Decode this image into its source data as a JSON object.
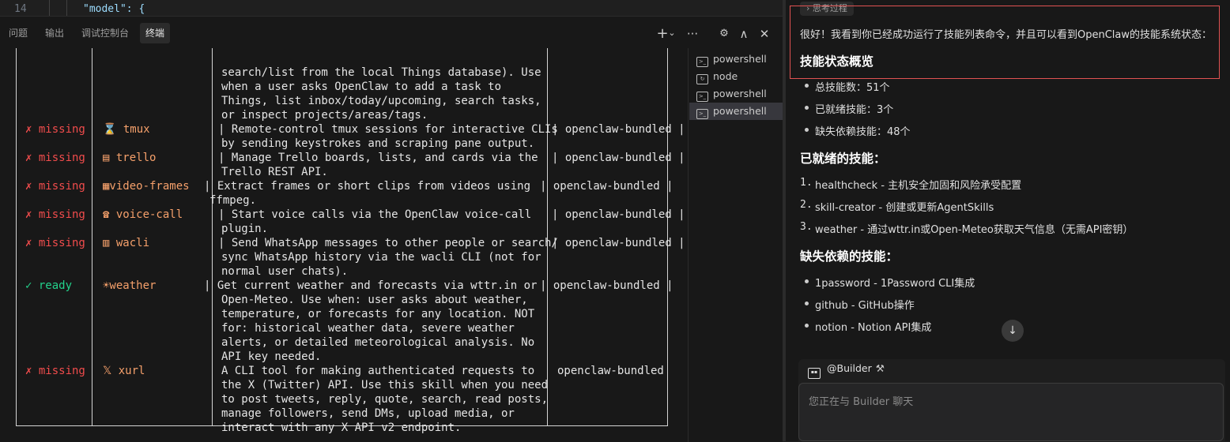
{
  "editor": {
    "line_number": "14",
    "code": "\"model\": {"
  },
  "panel": {
    "tabs": [
      "问题",
      "输出",
      "调试控制台",
      "终端"
    ],
    "active_tab": "终端",
    "actions": {
      "add": "+",
      "add_dropdown": "⌄",
      "more": "···",
      "layout": "⚙",
      "maximize": "∧",
      "close": "✕"
    }
  },
  "terminal": {
    "lines": [
      {
        "row": 0,
        "col": 280,
        "text": "search/list from the local Things database). Use",
        "style": "white"
      },
      {
        "row": 1,
        "col": 280,
        "text": "when a user asks OpenClaw to add a task to",
        "style": "white"
      },
      {
        "row": 2,
        "col": 280,
        "text": "Things, list inbox/today/upcoming, search tasks,",
        "style": "white"
      },
      {
        "row": 3,
        "col": 280,
        "text": "or inspect projects/areas/tags.",
        "style": "white"
      },
      {
        "row": 4,
        "col": 32,
        "text": "✗ missing",
        "style": "red"
      },
      {
        "row": 4,
        "col": 130,
        "text": "⌛ tmux",
        "style": "orange"
      },
      {
        "row": 4,
        "col": 276,
        "text": "| Remote-control tmux sessions for interactive CLIs",
        "style": "white"
      },
      {
        "row": 4,
        "col": 698,
        "text": "| openclaw-bundled |",
        "style": "white"
      },
      {
        "row": 5,
        "col": 280,
        "text": "by sending keystrokes and scraping pane output.",
        "style": "white"
      },
      {
        "row": 6,
        "col": 32,
        "text": "✗ missing",
        "style": "red"
      },
      {
        "row": 6,
        "col": 130,
        "text": "▤ trello",
        "style": "orange"
      },
      {
        "row": 6,
        "col": 276,
        "text": "| Manage Trello boards, lists, and cards via the",
        "style": "white"
      },
      {
        "row": 6,
        "col": 698,
        "text": "| openclaw-bundled |",
        "style": "white"
      },
      {
        "row": 7,
        "col": 280,
        "text": "Trello REST API.",
        "style": "white"
      },
      {
        "row": 8,
        "col": 32,
        "text": "✗ missing",
        "style": "red"
      },
      {
        "row": 8,
        "col": 130,
        "text": "▦video-frames",
        "style": "orange"
      },
      {
        "row": 8,
        "col": 258,
        "text": "| Extract frames or short clips from videos using",
        "style": "white"
      },
      {
        "row": 8,
        "col": 683,
        "text": "| openclaw-bundled |",
        "style": "white"
      },
      {
        "row": 9,
        "col": 265,
        "text": "ffmpeg.",
        "style": "white"
      },
      {
        "row": 10,
        "col": 32,
        "text": "✗ missing",
        "style": "red"
      },
      {
        "row": 10,
        "col": 130,
        "text": "☎ voice-call",
        "style": "orange"
      },
      {
        "row": 10,
        "col": 276,
        "text": "| Start voice calls via the OpenClaw voice-call",
        "style": "white"
      },
      {
        "row": 10,
        "col": 698,
        "text": "| openclaw-bundled |",
        "style": "white"
      },
      {
        "row": 11,
        "col": 280,
        "text": "plugin.",
        "style": "white"
      },
      {
        "row": 12,
        "col": 32,
        "text": "✗ missing",
        "style": "red"
      },
      {
        "row": 12,
        "col": 130,
        "text": "▥ wacli",
        "style": "orange"
      },
      {
        "row": 12,
        "col": 276,
        "text": "| Send WhatsApp messages to other people or search/",
        "style": "white"
      },
      {
        "row": 12,
        "col": 698,
        "text": "| openclaw-bundled |",
        "style": "white"
      },
      {
        "row": 13,
        "col": 280,
        "text": "sync WhatsApp history via the wacli CLI (not for",
        "style": "white"
      },
      {
        "row": 14,
        "col": 280,
        "text": "normal user chats).",
        "style": "white"
      },
      {
        "row": 15,
        "col": 32,
        "text": "✓ ready",
        "style": "green"
      },
      {
        "row": 15,
        "col": 130,
        "text": "☀weather",
        "style": "orange"
      },
      {
        "row": 15,
        "col": 258,
        "text": "| Get current weather and forecasts via wttr.in or",
        "style": "white"
      },
      {
        "row": 15,
        "col": 683,
        "text": "| openclaw-bundled |",
        "style": "white"
      },
      {
        "row": 16,
        "col": 280,
        "text": "Open-Meteo. Use when: user asks about weather,",
        "style": "white"
      },
      {
        "row": 17,
        "col": 280,
        "text": "temperature, or forecasts for any location. NOT",
        "style": "white"
      },
      {
        "row": 18,
        "col": 280,
        "text": "for: historical weather data, severe weather",
        "style": "white"
      },
      {
        "row": 19,
        "col": 280,
        "text": "alerts, or detailed meteorological analysis. No",
        "style": "white"
      },
      {
        "row": 20,
        "col": 280,
        "text": "API key needed.",
        "style": "white"
      },
      {
        "row": 21,
        "col": 32,
        "text": "✗ missing",
        "style": "red"
      },
      {
        "row": 21,
        "col": 130,
        "text": "𝕏 xurl",
        "style": "orange"
      },
      {
        "row": 21,
        "col": 280,
        "text": "A CLI tool for making authenticated requests to",
        "style": "white"
      },
      {
        "row": 21,
        "col": 705,
        "text": "openclaw-bundled",
        "style": "white"
      },
      {
        "row": 22,
        "col": 280,
        "text": "the X (Twitter) API. Use this skill when you need",
        "style": "white"
      },
      {
        "row": 23,
        "col": 280,
        "text": "to post tweets, reply, quote, search, read posts,",
        "style": "white"
      },
      {
        "row": 24,
        "col": 280,
        "text": "manage followers, send DMs, upload media, or",
        "style": "white"
      },
      {
        "row": 25,
        "col": 280,
        "text": "interact with any X API v2 endpoint.",
        "style": "white"
      }
    ],
    "sessions": [
      {
        "label": "powershell",
        "icon": "terminal-icon",
        "selected": false
      },
      {
        "label": "node",
        "icon": "terminal-debug-icon",
        "selected": false
      },
      {
        "label": "powershell",
        "icon": "terminal-icon",
        "selected": false
      },
      {
        "label": "powershell",
        "icon": "terminal-icon",
        "selected": true
      }
    ]
  },
  "chat": {
    "think_toggle": "› 思考过程",
    "intro": "很好！我看到你已经成功运行了技能列表命令，并且可以看到OpenClaw的技能系统状态：",
    "overview_heading": "技能状态概览",
    "overview_items": [
      "总技能数：51个",
      "已就绪技能：3个",
      "缺失依赖技能：48个"
    ],
    "ready_heading": "已就绪的技能：",
    "ready_items": [
      {
        "num": "1.",
        "text": "healthcheck - 主机安全加固和风险承受配置"
      },
      {
        "num": "2.",
        "text": "skill-creator - 创建或更新AgentSkills"
      },
      {
        "num": "3.",
        "text": "weather - 通过wttr.in或Open-Meteo获取天气信息（无需API密钥）"
      }
    ],
    "missing_heading": "缺失依赖的技能：",
    "missing_items": [
      "1password - 1Password CLI集成",
      "github - GitHub操作",
      "notion - Notion API集成"
    ],
    "scroll_down": "↓",
    "agent_label": "@Builder",
    "agent_tool_icon": "⚒",
    "input_placeholder": "您正在与 Builder 聊天"
  }
}
